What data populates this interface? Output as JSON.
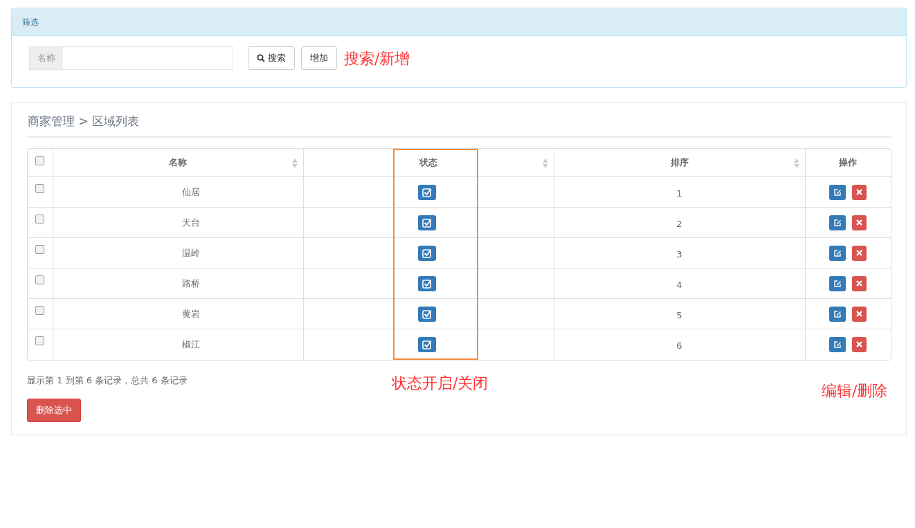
{
  "filter_panel": {
    "title": "筛选",
    "name_field": {
      "label": "名称"
    },
    "buttons": [
      {
        "kind": "search",
        "label": "搜索"
      },
      {
        "kind": "plain",
        "label": "增加"
      }
    ],
    "annotation": "搜索/新增"
  },
  "list_panel": {
    "breadcrumb": "商家管理 > 区域列表",
    "table": {
      "select_all_checked": false,
      "columns": [
        {
          "label": "名称",
          "sortable": true
        },
        {
          "label": "状态",
          "sortable": true
        },
        {
          "label": "排序",
          "sortable": true
        },
        {
          "label": "操作",
          "sortable": false
        }
      ],
      "rows": [
        {
          "checked": false,
          "name": "仙居",
          "enabled": true,
          "order": "1"
        },
        {
          "checked": false,
          "name": "天台",
          "enabled": true,
          "order": "2"
        },
        {
          "checked": false,
          "name": "温岭",
          "enabled": true,
          "order": "3"
        },
        {
          "checked": false,
          "name": "路桥",
          "enabled": true,
          "order": "4"
        },
        {
          "checked": false,
          "name": "黄岩",
          "enabled": true,
          "order": "5"
        },
        {
          "checked": false,
          "name": "椒江",
          "enabled": true,
          "order": "6"
        }
      ]
    },
    "summary": "显示第 1 到第 6 条记录，总共 6 条记录",
    "delete_selected": "删除选中",
    "annotations": [
      {
        "kind": "status",
        "text": "状态开启/关闭"
      },
      {
        "kind": "actions",
        "text": "编辑/删除"
      }
    ]
  }
}
